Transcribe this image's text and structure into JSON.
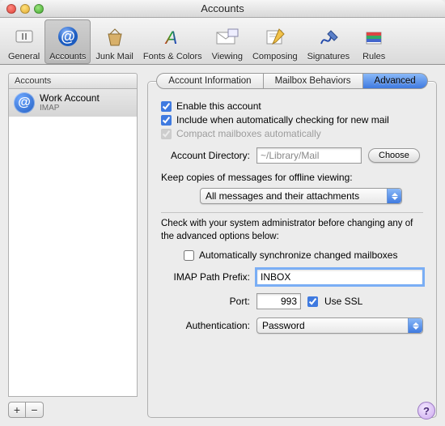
{
  "window": {
    "title": "Accounts"
  },
  "toolbar": {
    "items": [
      {
        "label": "General"
      },
      {
        "label": "Accounts"
      },
      {
        "label": "Junk Mail"
      },
      {
        "label": "Fonts & Colors"
      },
      {
        "label": "Viewing"
      },
      {
        "label": "Composing"
      },
      {
        "label": "Signatures"
      },
      {
        "label": "Rules"
      }
    ]
  },
  "sidebar": {
    "header": "Accounts",
    "account": {
      "name": "Work Account",
      "type": "IMAP",
      "glyph": "@"
    }
  },
  "tabs": [
    "Account Information",
    "Mailbox Behaviors",
    "Advanced"
  ],
  "advanced": {
    "enable_label": "Enable this account",
    "include_label": "Include when automatically checking for new mail",
    "compact_label": "Compact mailboxes automatically",
    "dir_label": "Account Directory:",
    "dir_value": "~/Library/Mail",
    "choose": "Choose",
    "offline_label": "Keep copies of messages for offline viewing:",
    "offline_value": "All messages and their attachments",
    "admin_note": "Check with your system administrator before changing any of the advanced options below:",
    "sync_label": "Automatically synchronize changed mailboxes",
    "prefix_label": "IMAP Path Prefix:",
    "prefix_value": "INBOX",
    "port_label": "Port:",
    "port_value": "993",
    "ssl_label": "Use SSL",
    "auth_label": "Authentication:",
    "auth_value": "Password"
  },
  "buttons": {
    "add": "+",
    "remove": "−",
    "help": "?"
  }
}
